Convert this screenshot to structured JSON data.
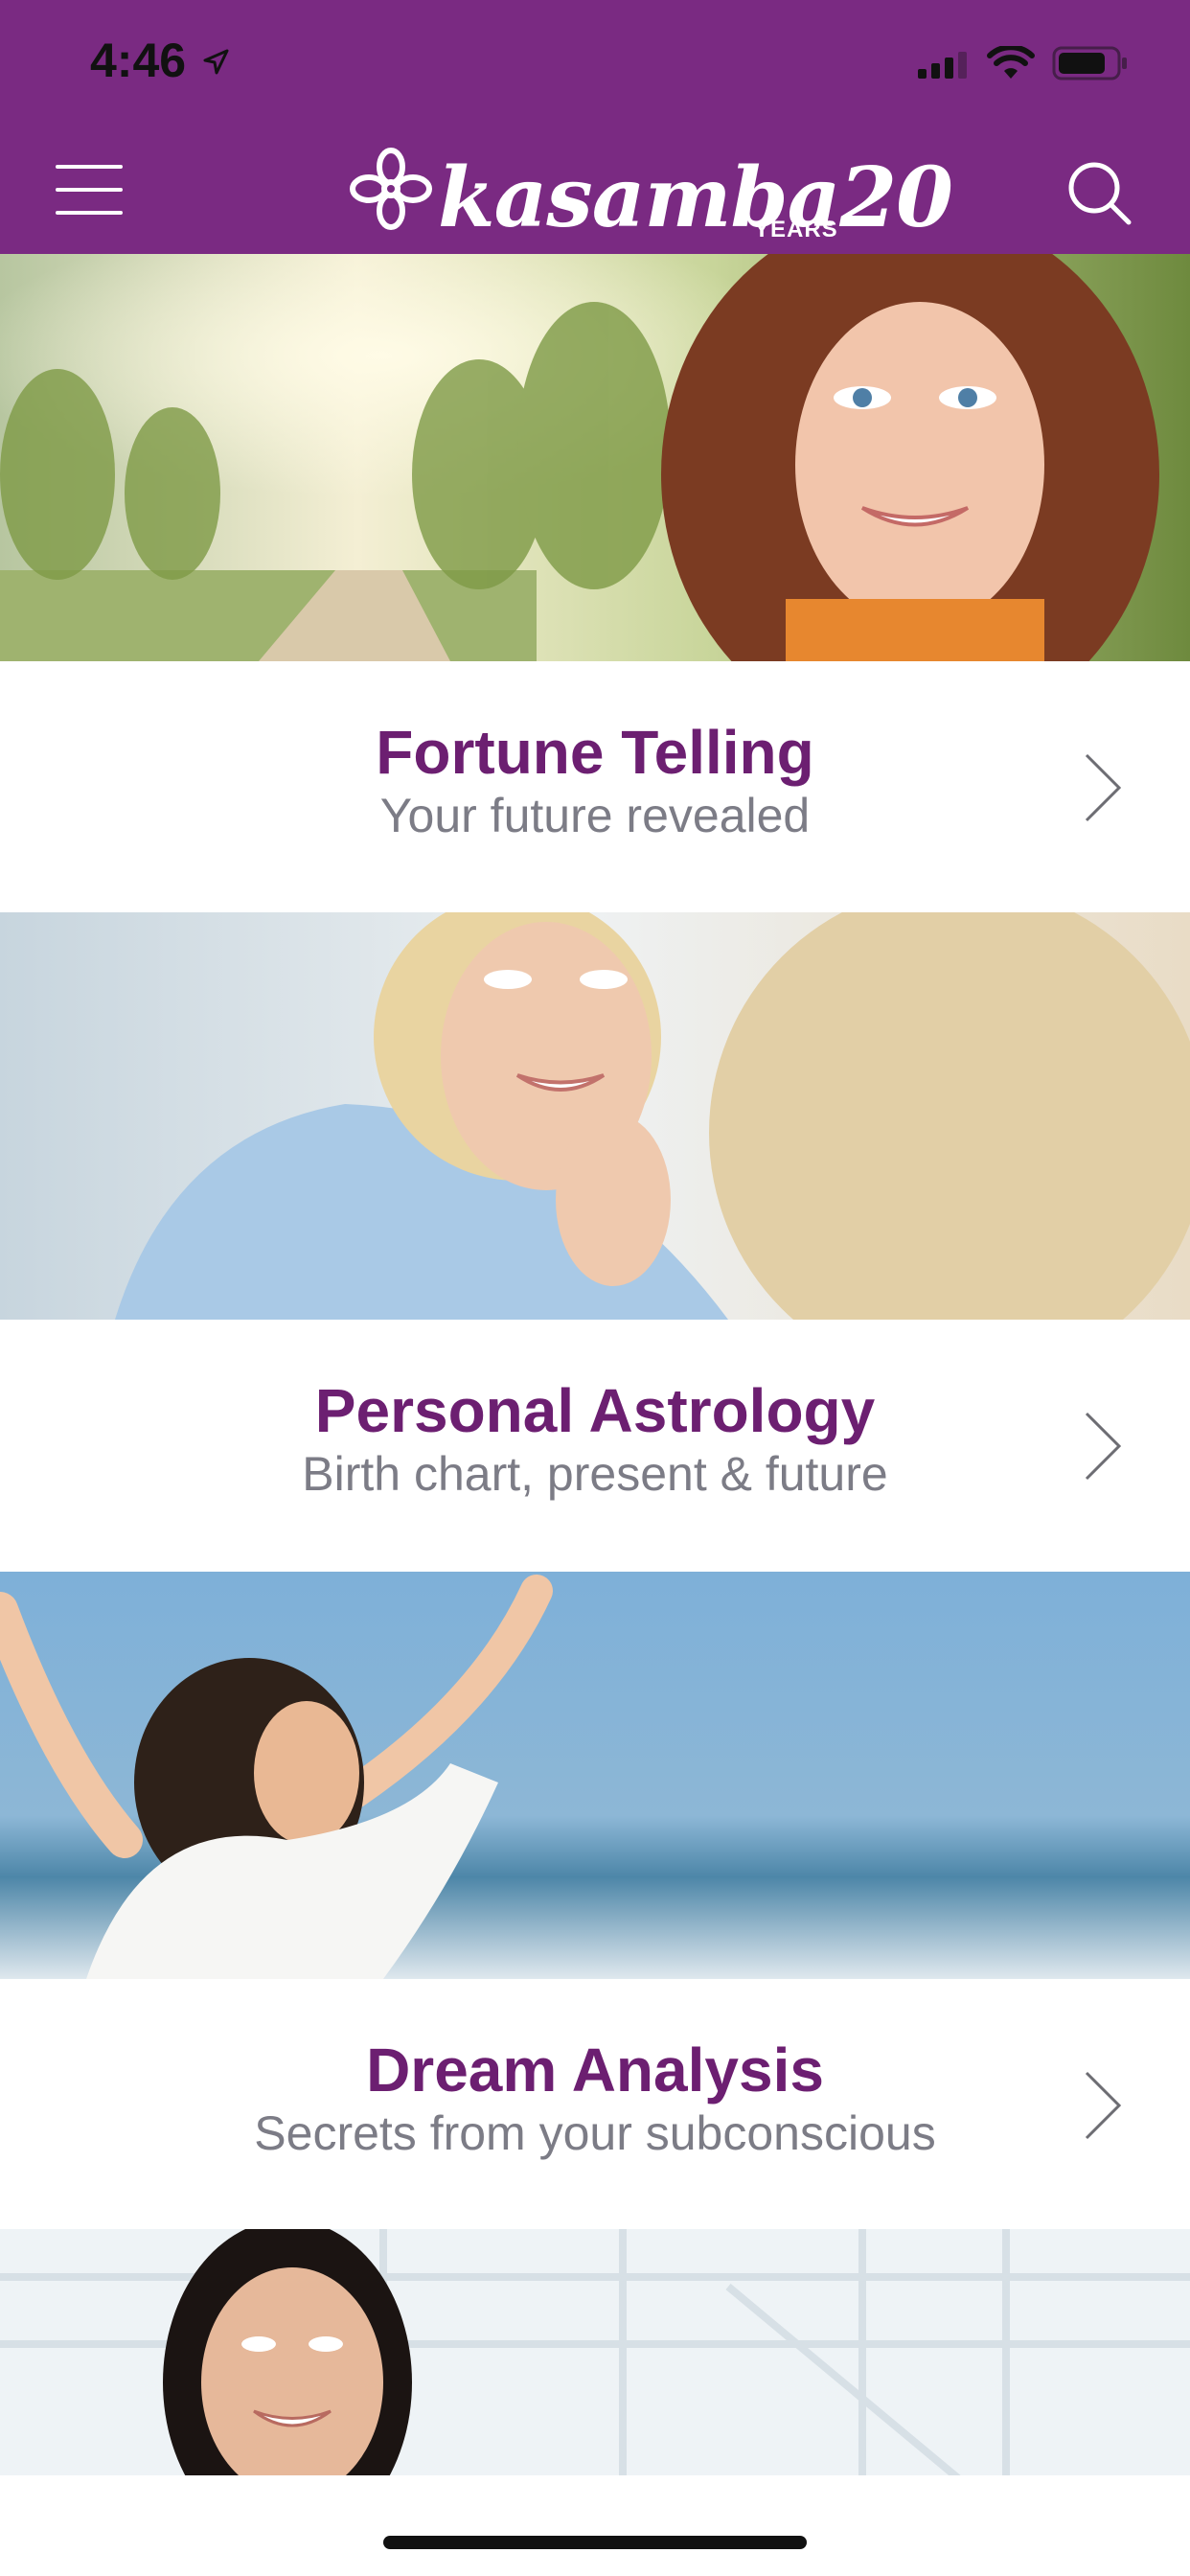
{
  "status_bar": {
    "time": "4:46"
  },
  "header": {
    "brand": "kasamba20",
    "brand_years": "YEARS",
    "icons": {
      "menu": "hamburger-menu-icon",
      "search": "search-icon",
      "logo": "flower-logo-icon"
    },
    "background_color": "#7a2a82"
  },
  "categories": [
    {
      "title": "Fortune Telling",
      "subtitle": "Your future revealed",
      "image": "smiling-woman-in-park-photo"
    },
    {
      "title": "Personal Astrology",
      "subtitle": "Birth chart, present & future",
      "image": "women-conversation-photo"
    },
    {
      "title": "Dream Analysis",
      "subtitle": "Secrets from your subconscious",
      "image": "woman-arms-raised-beach-photo"
    },
    {
      "title": "",
      "subtitle": "",
      "image": "smiling-woman-office-photo"
    }
  ],
  "colors": {
    "title": "#6c1f71",
    "subtitle": "#7c7c86",
    "chevron": "#6d6d73"
  }
}
